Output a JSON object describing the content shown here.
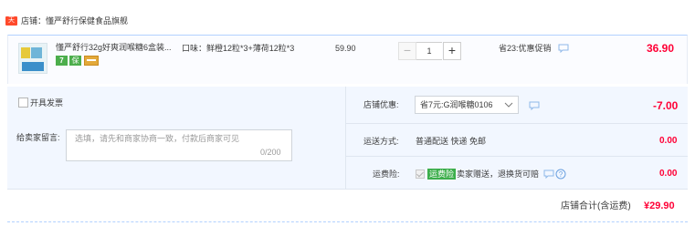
{
  "store": {
    "tag": "天猫",
    "label": "店铺：懂严舒行保健食品旗舰"
  },
  "item": {
    "title": "懂严舒行32g好爽润喉糖6盒装...",
    "badge_7": "7",
    "badge_shield": "保",
    "sku": "口味：鲜橙12粒*3+薄荷12粒*3",
    "unit_price": "59.90",
    "qty_minus": "−",
    "quantity": "1",
    "qty_plus": "+",
    "promo": "省23:优惠促销",
    "total": "36.90"
  },
  "invoice": {
    "label": "开具发票"
  },
  "message": {
    "label": "给卖家留言:",
    "placeholder": "选填，请先和商家协商一致，付款后商家可见",
    "counter": "0/200"
  },
  "shop_discount": {
    "label": "店铺优惠:",
    "selected": "省7元:G润喉糖0106",
    "amount": "-7.00"
  },
  "shipping": {
    "label": "运送方式:",
    "value": "普通配送 快递 免邮",
    "amount": "0.00"
  },
  "insurance": {
    "label": "运费险:",
    "badge": "运费险",
    "text": "卖家赠送，退换货可赔",
    "amount": "0.00"
  },
  "summary": {
    "label": "店铺合计(含运费)",
    "value": "¥29.90"
  },
  "colors": {
    "price_red": "#ff0036",
    "panel_bg": "#f2f7ff",
    "accent_blue": "#b2d1ff",
    "badge_green": "#3cae4b",
    "store_tag_red": "#ff4a2c"
  },
  "icons": {
    "chat": "chat-bubble-icon",
    "chevron": "chevron-down-icon",
    "help": "help-circle-icon"
  }
}
